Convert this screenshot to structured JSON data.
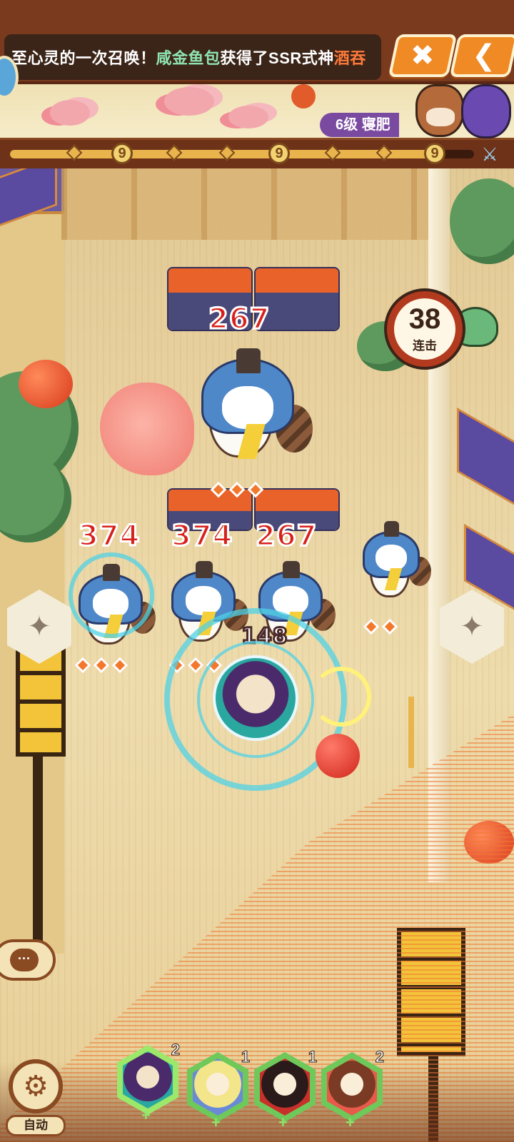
{
  "announcement": {
    "prefix": "至心灵的一次召唤！",
    "player": "咸金鱼包",
    "middle": "获得了SSR式神",
    "shikigami": "酒吞"
  },
  "top_buttons": {
    "close_icon": "✖",
    "back_icon": "❮"
  },
  "boss": {
    "level": "6级",
    "name": "寝肥"
  },
  "progress": {
    "milestone_label": "9",
    "fill_fraction": 0.92
  },
  "combo": {
    "count": "38",
    "label": "连击"
  },
  "damage_numbers": {
    "big_enemy": "267",
    "left_enemy": "374",
    "mid_enemy": "374",
    "right_enemy": "267",
    "player_hit": "148"
  },
  "auto": {
    "label": "自动"
  },
  "heroes": [
    {
      "count": "2",
      "name": "hero-1"
    },
    {
      "count": "1",
      "name": "hero-2"
    },
    {
      "count": "1",
      "name": "hero-3"
    },
    {
      "count": "2",
      "name": "hero-4"
    }
  ],
  "colors": {
    "frame": "#7a3a1e",
    "accent_orange": "#f08a24",
    "damage_red": "#d8201a",
    "hero_hex_green": "#6fc85a"
  }
}
